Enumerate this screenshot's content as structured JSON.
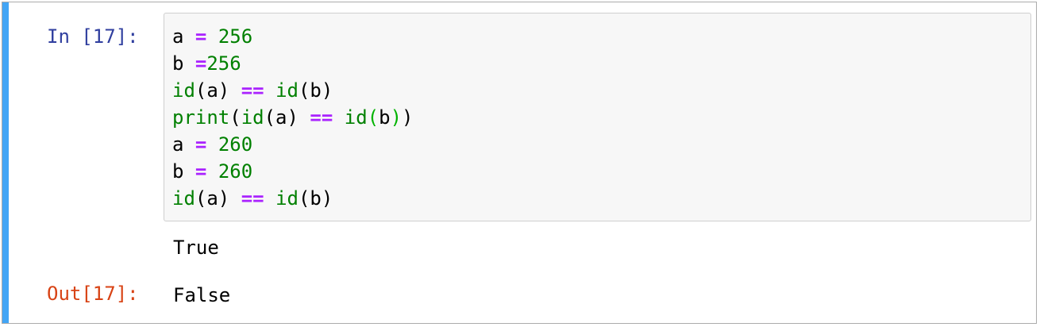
{
  "cell": {
    "in_prompt": "In [17]:",
    "out_prompt": "Out[17]:",
    "code_lines": [
      [
        {
          "t": "a",
          "k": "name"
        },
        {
          "t": " ",
          "k": "punc"
        },
        {
          "t": "=",
          "k": "op"
        },
        {
          "t": " ",
          "k": "punc"
        },
        {
          "t": "256",
          "k": "num"
        }
      ],
      [
        {
          "t": "b",
          "k": "name"
        },
        {
          "t": " ",
          "k": "punc"
        },
        {
          "t": "=",
          "k": "op"
        },
        {
          "t": "256",
          "k": "num"
        }
      ],
      [
        {
          "t": "id",
          "k": "builtin"
        },
        {
          "t": "(a)",
          "k": "punc"
        },
        {
          "t": " ",
          "k": "punc"
        },
        {
          "t": "==",
          "k": "op"
        },
        {
          "t": " ",
          "k": "punc"
        },
        {
          "t": "id",
          "k": "builtin"
        },
        {
          "t": "(b)",
          "k": "punc"
        }
      ],
      [
        {
          "t": "print",
          "k": "builtin"
        },
        {
          "t": "(",
          "k": "punc"
        },
        {
          "t": "id",
          "k": "builtin"
        },
        {
          "t": "(a)",
          "k": "punc"
        },
        {
          "t": " ",
          "k": "punc"
        },
        {
          "t": "==",
          "k": "op"
        },
        {
          "t": " ",
          "k": "punc"
        },
        {
          "t": "id",
          "k": "builtin"
        },
        {
          "t": "(",
          "k": "match"
        },
        {
          "t": "b",
          "k": "punc"
        },
        {
          "t": ")",
          "k": "match"
        },
        {
          "t": ")",
          "k": "punc"
        }
      ],
      [
        {
          "t": "a",
          "k": "name"
        },
        {
          "t": " ",
          "k": "punc"
        },
        {
          "t": "=",
          "k": "op"
        },
        {
          "t": " ",
          "k": "punc"
        },
        {
          "t": "260",
          "k": "num"
        }
      ],
      [
        {
          "t": "b",
          "k": "name"
        },
        {
          "t": " ",
          "k": "punc"
        },
        {
          "t": "=",
          "k": "op"
        },
        {
          "t": " ",
          "k": "punc"
        },
        {
          "t": "260",
          "k": "num"
        }
      ],
      [
        {
          "t": "id",
          "k": "builtin"
        },
        {
          "t": "(a)",
          "k": "punc"
        },
        {
          "t": " ",
          "k": "punc"
        },
        {
          "t": "==",
          "k": "op"
        },
        {
          "t": " ",
          "k": "punc"
        },
        {
          "t": "id",
          "k": "builtin"
        },
        {
          "t": "(b)",
          "k": "punc"
        }
      ]
    ],
    "stream_output": "True",
    "result_output": "False"
  },
  "colors": {
    "selection_bar": "#42a5f5",
    "in_prompt": "#303f9f",
    "out_prompt": "#d84315",
    "operator": "#aa22ff",
    "number": "#008000",
    "builtin": "#008000"
  }
}
